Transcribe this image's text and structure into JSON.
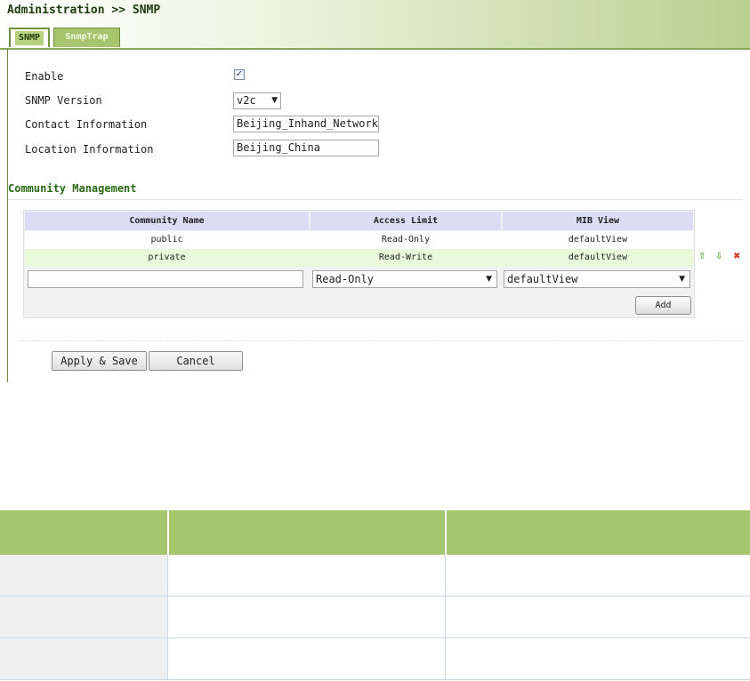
{
  "header": {
    "title": "Administration >> SNMP",
    "tabs": [
      {
        "label": "SNMP",
        "active": true
      },
      {
        "label": "SnmpTrap",
        "active": false
      }
    ]
  },
  "form": {
    "enable": {
      "label": "Enable",
      "checked": true,
      "check_glyph": "✓"
    },
    "version": {
      "label": "SNMP Version",
      "value": "v2c"
    },
    "contact": {
      "label": "Contact Information",
      "value": "Beijing_Inhand_Networks"
    },
    "location": {
      "label": "Location Information",
      "value": "Beijing_China"
    }
  },
  "community": {
    "title": "Community Management",
    "columns": [
      "Community Name",
      "Access Limit",
      "MIB View"
    ],
    "rows": [
      {
        "name": "public",
        "access": "Read-Only",
        "view": "defaultView"
      },
      {
        "name": "private",
        "access": "Read-Write",
        "view": "defaultView"
      }
    ],
    "new_row": {
      "name": "",
      "access": "Read-Only",
      "view": "defaultView"
    },
    "add_label": "Add",
    "row_icons": {
      "up": "⇧",
      "down": "⇩",
      "delete": "✖"
    }
  },
  "buttons": {
    "apply": "Apply & Save",
    "cancel": "Cancel"
  },
  "colors": {
    "accent_green": "#a3c66e",
    "header_green": "#b9d08f",
    "row_highlight": "#e8f9dc",
    "table_header": "#dcdcf4",
    "delete_red": "#d9342b",
    "arrow_green": "#69a33a"
  }
}
